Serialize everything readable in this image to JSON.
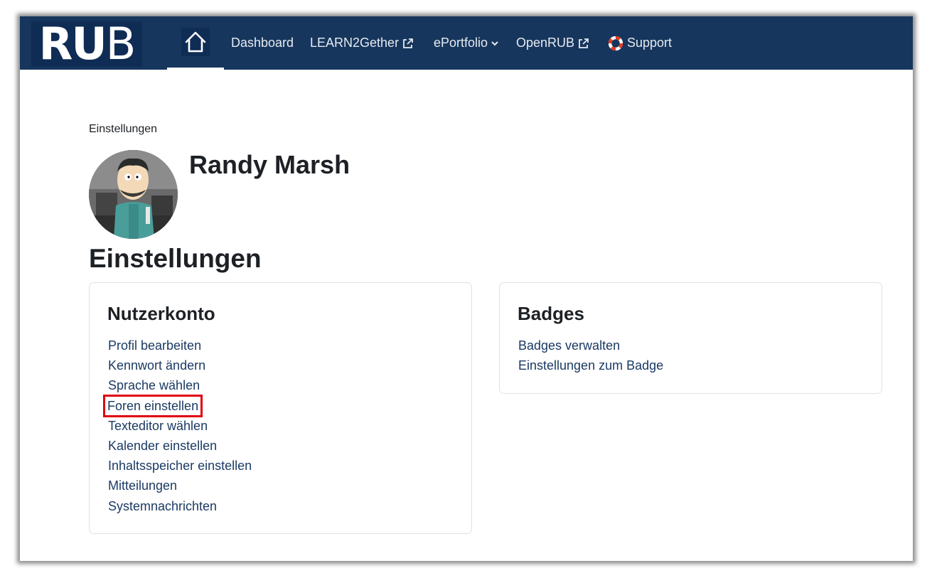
{
  "nav": {
    "logo_main": "RU",
    "logo_end": "B",
    "links": [
      {
        "label": "Dashboard"
      },
      {
        "label": "LEARN2Gether"
      },
      {
        "label": "ePortfolio"
      },
      {
        "label": "OpenRUB"
      },
      {
        "label": "Support"
      }
    ]
  },
  "breadcrumb": "Einstellungen",
  "user": {
    "name": "Randy Marsh"
  },
  "page_title": "Einstellungen",
  "account_card": {
    "title": "Nutzerkonto",
    "items": [
      {
        "label": "Profil bearbeiten"
      },
      {
        "label": "Kennwort ändern"
      },
      {
        "label": "Sprache wählen"
      },
      {
        "label": "Foren einstellen"
      },
      {
        "label": "Texteditor wählen"
      },
      {
        "label": "Kalender einstellen"
      },
      {
        "label": "Inhaltsspeicher einstellen"
      },
      {
        "label": "Mitteilungen"
      },
      {
        "label": "Systemnachrichten"
      }
    ]
  },
  "badges_card": {
    "title": "Badges",
    "items": [
      {
        "label": "Badges verwalten"
      },
      {
        "label": "Einstellungen zum Badge"
      }
    ]
  },
  "colors": {
    "navbar": "#17365d",
    "link": "#1b3a63",
    "highlight": "#e0000f"
  }
}
